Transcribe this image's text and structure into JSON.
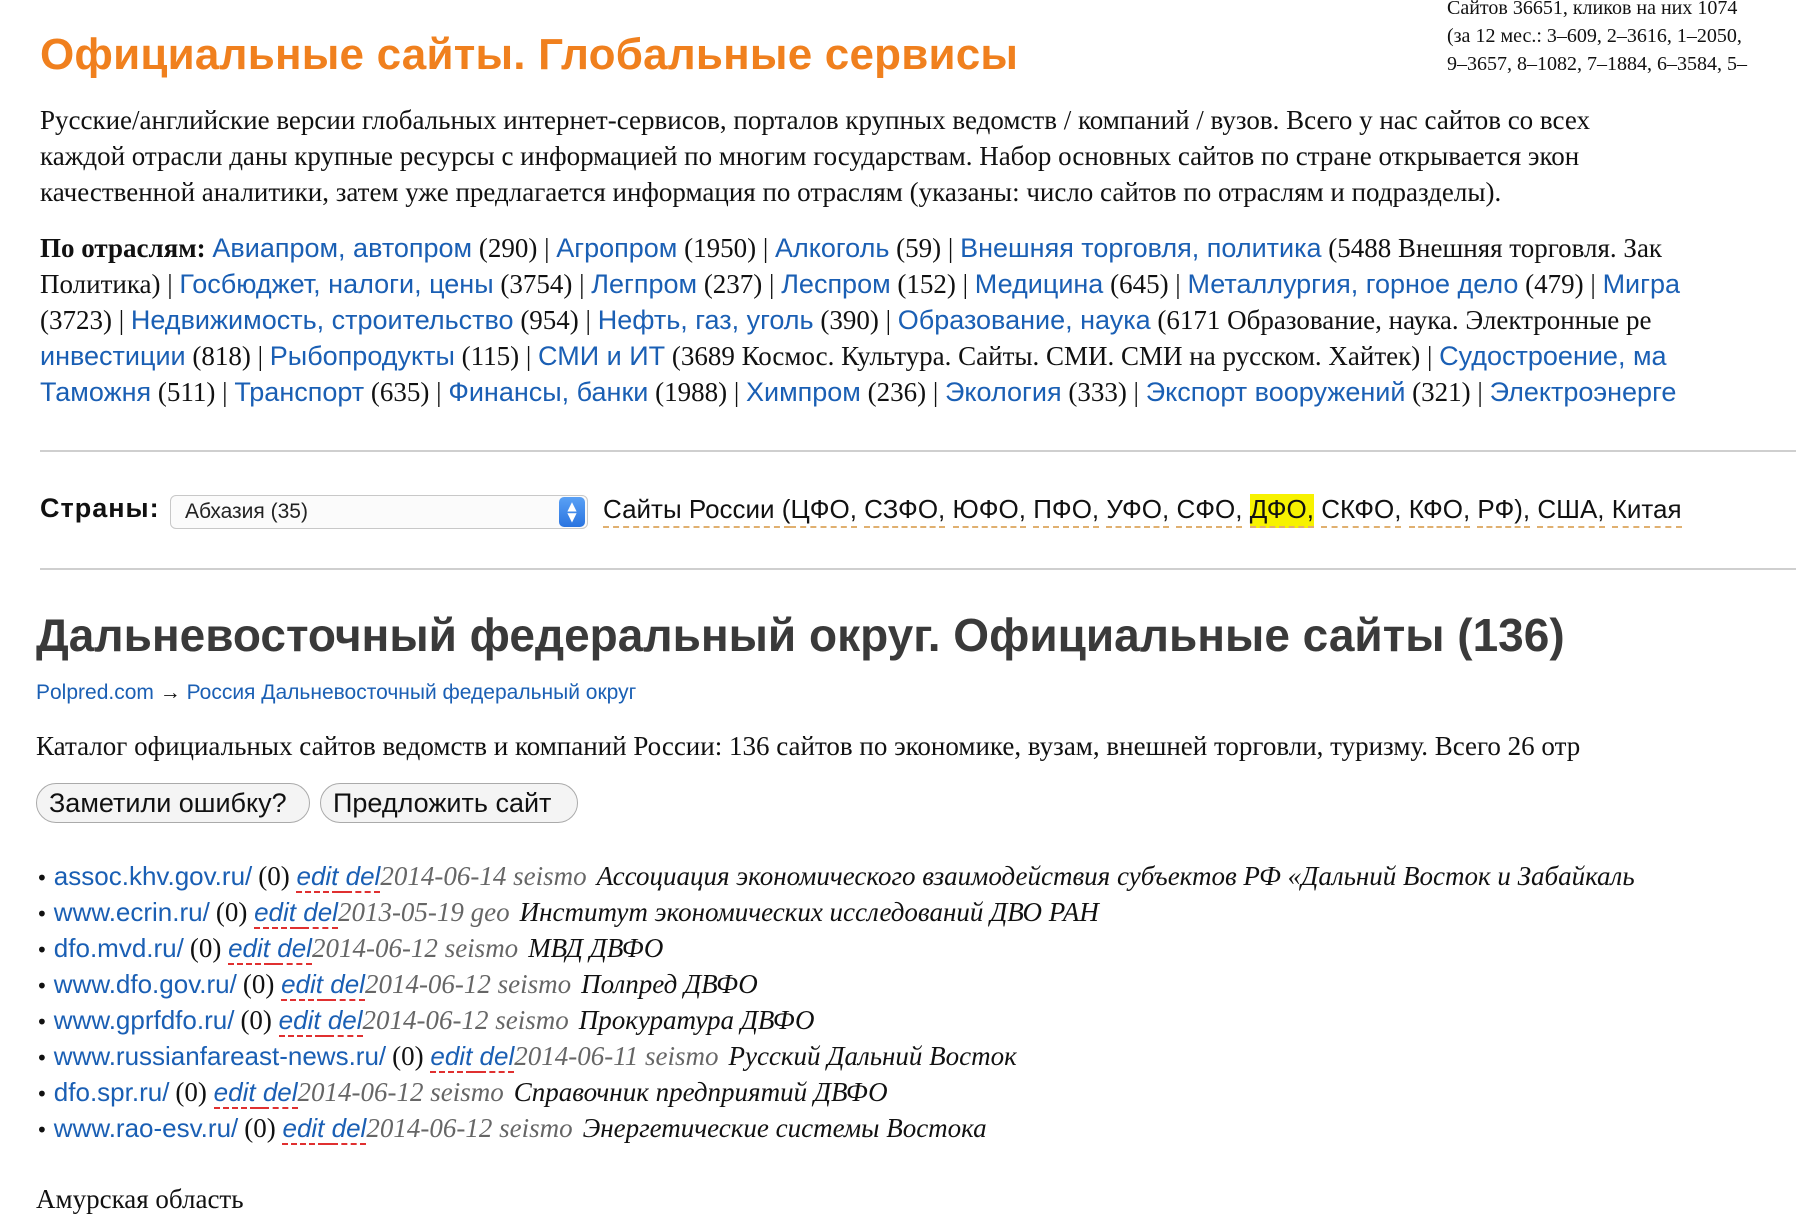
{
  "stats": {
    "line1": "Сайтов 36651, кликов на них 1074",
    "line2": "(за 12 мес.: 3–609, 2–3616, 1–2050,",
    "line3": "9–3657, 8–1082, 7–1884, 6–3584, 5–"
  },
  "site_title": "Официальные сайты. Глобальные сервисы",
  "intro": {
    "line1": "Русские/английские версии глобальных интернет-сервисов, порталов крупных ведомств / компаний / вузов. Всего у нас сайтов со всех",
    "line2": "каждой отрасли даны крупные ресурсы с информацией по многим государствам. Набор основных сайтов по стране открывается экон",
    "line3": "качественной аналитики, затем уже предлагается информация по отраслям (указаны: число сайтов по отраслям и подразделы)."
  },
  "industries": {
    "label": "По отраслям:",
    "items": [
      {
        "name": "Авиапром, автопром",
        "tail": "(290) | "
      },
      {
        "name": "Агропром",
        "tail": "(1950) | "
      },
      {
        "name": "Алкоголь",
        "tail": "(59) | "
      },
      {
        "name": "Внешняя торговля, политика",
        "tail": "(5488 Внешняя торговля. Зак"
      },
      {
        "pre": "Политика) | ",
        "name": "Госбюджет, налоги, цены",
        "tail": "(3754) | "
      },
      {
        "name": "Легпром",
        "tail": "(237) | "
      },
      {
        "name": "Леспром",
        "tail": "(152) | "
      },
      {
        "name": "Медицина",
        "tail": "(645) | "
      },
      {
        "name": "Металлургия, горное дело",
        "tail": "(479) | "
      },
      {
        "name": "Мигра",
        "tail": ""
      },
      {
        "pre": "(3723) | ",
        "name": "Недвижимость, строительство",
        "tail": "(954) | "
      },
      {
        "name": "Нефть, газ, уголь",
        "tail": "(390) | "
      },
      {
        "name": "Образование, наука",
        "tail": "(6171 Образование, наука. Электронные ре"
      },
      {
        "name": "инвестиции",
        "tail": "(818) | "
      },
      {
        "name": "Рыбопродукты",
        "tail": "(115) | "
      },
      {
        "name": "СМИ и ИТ",
        "tail": "(3689 Космос. Культура. Сайты. СМИ. СМИ на русском. Хайтек) | "
      },
      {
        "name": "Судостроение, ма",
        "tail": ""
      },
      {
        "name": "Таможня",
        "tail": "(511) | "
      },
      {
        "name": "Транспорт",
        "tail": "(635) | "
      },
      {
        "name": "Финансы, банки",
        "tail": "(1988) | "
      },
      {
        "name": "Химпром",
        "tail": "(236) | "
      },
      {
        "name": "Экология",
        "tail": "(333) | "
      },
      {
        "name": "Экспорт вооружений",
        "tail": "(321) | "
      },
      {
        "name": "Электроэнерге",
        "tail": ""
      }
    ]
  },
  "countries": {
    "label": "Страны:",
    "select_value": "Абхазия (35)",
    "links": {
      "russia": "Сайты России (",
      "cfo": "ЦФО,",
      "szfo": "СЗФО,",
      "yufo": "ЮФО,",
      "pfo": "ПФО,",
      "ufo": "УФО,",
      "sfo": "СФО,",
      "dfo": "ДФО,",
      "skfo": "СКФО,",
      "kfo": "КФО,",
      "rf": "РФ),",
      "usa": "США,",
      "china": "Китая"
    }
  },
  "page_title": "Дальневосточный федеральный округ. Официальные сайты (136)",
  "breadcrumb": {
    "home": "Polpred.com",
    "arrow": " → ",
    "current": "Россия Дальневосточный федеральный округ"
  },
  "catalog_desc": "Каталог официальных сайтов ведомств и компаний России: 136 сайтов по экономике, вузам, внешней торговли, туризму. Всего 26 отр",
  "buttons": {
    "report_error": "Заметили ошибку?",
    "suggest_site": "Предложить сайт"
  },
  "sites": [
    {
      "url": "assoc.khv.gov.ru/",
      "count": "(0)",
      "edit": "edit",
      "del": "del",
      "date": "2014-06-14",
      "user": "seismo",
      "title": "Ассоциация экономического взаимодействия субъектов РФ «Дальний Восток и Забайкаль"
    },
    {
      "url": "www.ecrin.ru/",
      "count": "(0)",
      "edit": "edit",
      "del": "del",
      "date": "2013-05-19",
      "user": "geo",
      "title": "Институт экономических исследований ДВО РАН"
    },
    {
      "url": "dfo.mvd.ru/",
      "count": "(0)",
      "edit": "edit",
      "del": "del",
      "date": "2014-06-12",
      "user": "seismo",
      "title": "МВД ДВФО"
    },
    {
      "url": "www.dfo.gov.ru/",
      "count": "(0)",
      "edit": "edit",
      "del": "del",
      "date": "2014-06-12",
      "user": "seismo",
      "title": "Полпред ДВФО"
    },
    {
      "url": "www.gprfdfo.ru/",
      "count": "(0)",
      "edit": "edit",
      "del": "del",
      "date": "2014-06-12",
      "user": "seismo",
      "title": "Прокуратура ДВФО"
    },
    {
      "url": "www.russianfareast-news.ru/",
      "count": "(0)",
      "edit": "edit",
      "del": "del",
      "date": "2014-06-11",
      "user": "seismo",
      "title": "Русский Дальний Восток"
    },
    {
      "url": "dfo.spr.ru/",
      "count": "(0)",
      "edit": "edit",
      "del": "del",
      "date": "2014-06-12",
      "user": "seismo",
      "title": "Справочник предприятий ДВФО"
    },
    {
      "url": "www.rao-esv.ru/",
      "count": "(0)",
      "edit": "edit",
      "del": "del",
      "date": "2014-06-12",
      "user": "seismo",
      "title": "Энергетические системы Востока"
    }
  ],
  "next_region": "Амурская область",
  "colors": {
    "title_orange": "#f0801e",
    "link_blue": "#1a5fb4",
    "highlight": "#f7f200"
  }
}
